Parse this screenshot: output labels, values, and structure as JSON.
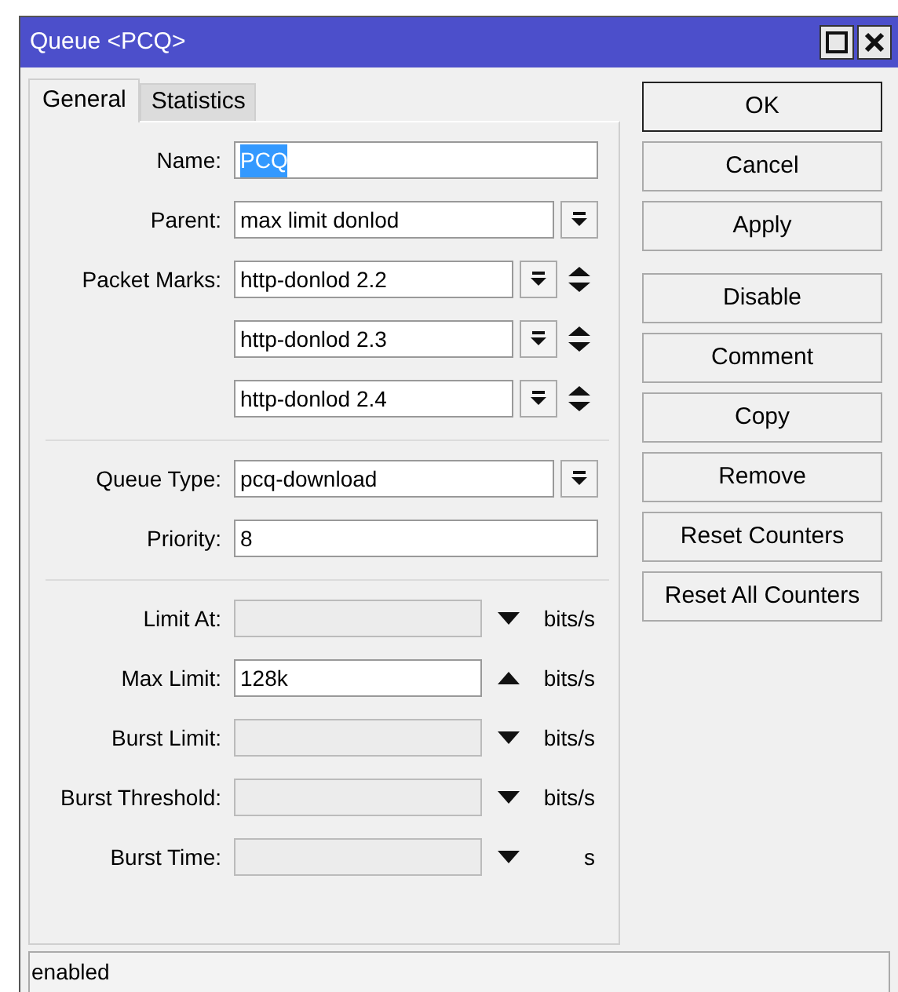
{
  "window": {
    "title": "Queue <PCQ>"
  },
  "tabs": [
    {
      "label": "General",
      "selected": true
    },
    {
      "label": "Statistics",
      "selected": false
    }
  ],
  "sections": [
    [
      {
        "kind": "text",
        "label": "Name:",
        "value": "PCQ",
        "selected": true
      },
      {
        "kind": "select",
        "label": "Parent:",
        "value": "max limit donlod"
      },
      {
        "kind": "mark",
        "label": "Packet Marks:",
        "value": "http-donlod 2.2"
      },
      {
        "kind": "mark",
        "value": "http-donlod 2.3"
      },
      {
        "kind": "mark",
        "value": "http-donlod 2.4"
      }
    ],
    [
      {
        "kind": "select",
        "label": "Queue Type:",
        "value": "pcq-download"
      },
      {
        "kind": "text",
        "label": "Priority:",
        "value": "8",
        "selected": false
      }
    ],
    [
      {
        "kind": "limit",
        "label": "Limit At:",
        "disabled": true,
        "expanded": false,
        "unit": "bits/s"
      },
      {
        "kind": "limit",
        "label": "Max Limit:",
        "value": "128k",
        "disabled": false,
        "expanded": true,
        "unit": "bits/s"
      },
      {
        "kind": "limit",
        "label": "Burst Limit:",
        "disabled": true,
        "expanded": false,
        "unit": "bits/s"
      },
      {
        "kind": "limit",
        "label": "Burst Threshold:",
        "disabled": true,
        "expanded": false,
        "unit": "bits/s"
      },
      {
        "kind": "limit",
        "label": "Burst Time:",
        "disabled": true,
        "expanded": false,
        "unit": "s"
      }
    ]
  ],
  "button_groups": [
    [
      {
        "label": "OK",
        "default": true
      },
      {
        "label": "Cancel",
        "default": false
      },
      {
        "label": "Apply",
        "default": false
      }
    ],
    [
      {
        "label": "Disable",
        "default": false
      },
      {
        "label": "Comment",
        "default": false
      },
      {
        "label": "Copy",
        "default": false
      },
      {
        "label": "Remove",
        "default": false
      },
      {
        "label": "Reset Counters",
        "default": false
      },
      {
        "label": "Reset All Counters",
        "default": false
      }
    ]
  ],
  "status_bar": "enabled"
}
